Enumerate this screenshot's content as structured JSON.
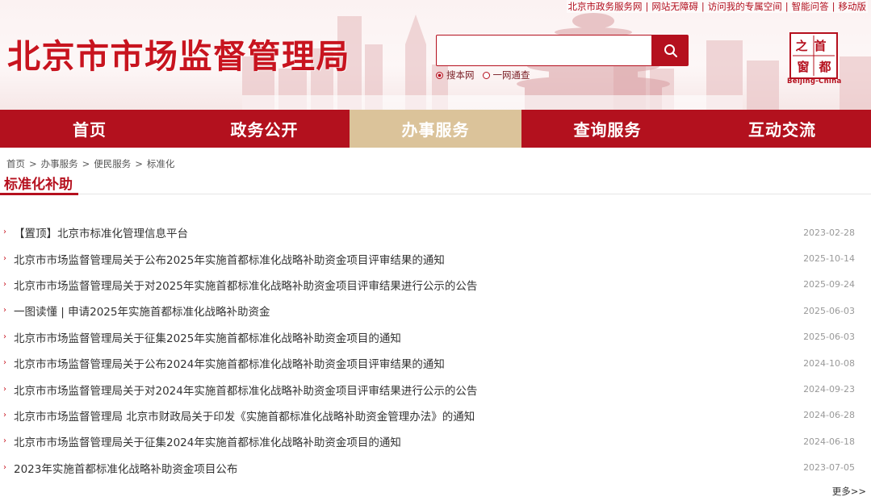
{
  "top_links": [
    {
      "label": "北京市政务服务网"
    },
    {
      "label": "网站无障碍"
    },
    {
      "label": "访问我的专属空间"
    },
    {
      "label": "智能问答"
    },
    {
      "label": "移动版"
    }
  ],
  "site_title": "北京市市场监督管理局",
  "search": {
    "placeholder": "",
    "value": "",
    "scope_options": [
      {
        "label": "搜本网",
        "selected": true
      },
      {
        "label": "一网通查",
        "selected": false
      }
    ]
  },
  "logo": {
    "chars": [
      "首",
      "都",
      "之",
      "窗"
    ],
    "caption": "Beijing-China"
  },
  "nav": [
    {
      "label": "首页",
      "active": false
    },
    {
      "label": "政务公开",
      "active": false
    },
    {
      "label": "办事服务",
      "active": true
    },
    {
      "label": "查询服务",
      "active": false
    },
    {
      "label": "互动交流",
      "active": false
    }
  ],
  "breadcrumb": [
    "首页",
    "办事服务",
    "便民服务",
    "标准化"
  ],
  "section_title": "标准化补助",
  "articles": [
    {
      "title": "【置顶】北京市标准化管理信息平台",
      "date": "2023-02-28"
    },
    {
      "title": "北京市市场监督管理局关于公布2025年实施首都标准化战略补助资金项目评审结果的通知",
      "date": "2025-10-14"
    },
    {
      "title": "北京市市场监督管理局关于对2025年实施首都标准化战略补助资金项目评审结果进行公示的公告",
      "date": "2025-09-24"
    },
    {
      "title": "一图读懂 | 申请2025年实施首都标准化战略补助资金",
      "date": "2025-06-03"
    },
    {
      "title": "北京市市场监督管理局关于征集2025年实施首都标准化战略补助资金项目的通知",
      "date": "2025-06-03"
    },
    {
      "title": "北京市市场监督管理局关于公布2024年实施首都标准化战略补助资金项目评审结果的通知",
      "date": "2024-10-08"
    },
    {
      "title": "北京市市场监督管理局关于对2024年实施首都标准化战略补助资金项目评审结果进行公示的公告",
      "date": "2024-09-23"
    },
    {
      "title": "北京市市场监督管理局 北京市财政局关于印发《实施首都标准化战略补助资金管理办法》的通知",
      "date": "2024-06-28"
    },
    {
      "title": "北京市市场监督管理局关于征集2024年实施首都标准化战略补助资金项目的通知",
      "date": "2024-06-18"
    },
    {
      "title": "2023年实施首都标准化战略补助资金项目公布",
      "date": "2023-07-05"
    }
  ],
  "more_label": "更多>>",
  "colors": {
    "brand_red": "#b3111e",
    "active_nav": "#dbc39a",
    "date_gray": "#999999"
  }
}
